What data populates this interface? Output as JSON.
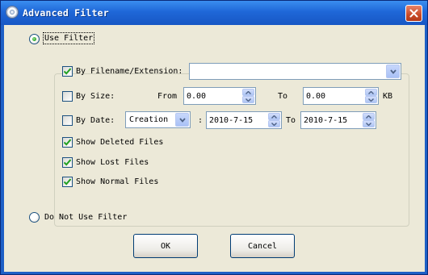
{
  "window": {
    "title": "Advanced Filter",
    "icon": "disc-icon",
    "close_icon": "close-icon"
  },
  "use_filter": {
    "label": "Use Filter",
    "selected": true
  },
  "filename_filter": {
    "label": "By Filename/Extension:",
    "checked": true,
    "value": ""
  },
  "size_filter": {
    "label": "By Size:",
    "checked": false,
    "from_label": "From",
    "from_value": "0.00",
    "to_label": "To",
    "to_value": "0.00",
    "unit": "KB"
  },
  "date_filter": {
    "label": "By Date:",
    "checked": false,
    "type_value": "Creation",
    "separator": ":",
    "from_value": "2010-7-15",
    "to_label": "To",
    "to_value": "2010-7-15"
  },
  "show_deleted": {
    "label": "Show Deleted Files",
    "checked": true
  },
  "show_lost": {
    "label": "Show Lost Files",
    "checked": true
  },
  "show_normal": {
    "label": "Show Normal Files",
    "checked": true
  },
  "no_filter": {
    "label": "Do Not Use Filter",
    "selected": false
  },
  "buttons": {
    "ok": "OK",
    "cancel": "Cancel"
  },
  "colors": {
    "titlebar": "#1f67d8",
    "client_bg": "#ece9d8",
    "check_green": "#21a121"
  }
}
